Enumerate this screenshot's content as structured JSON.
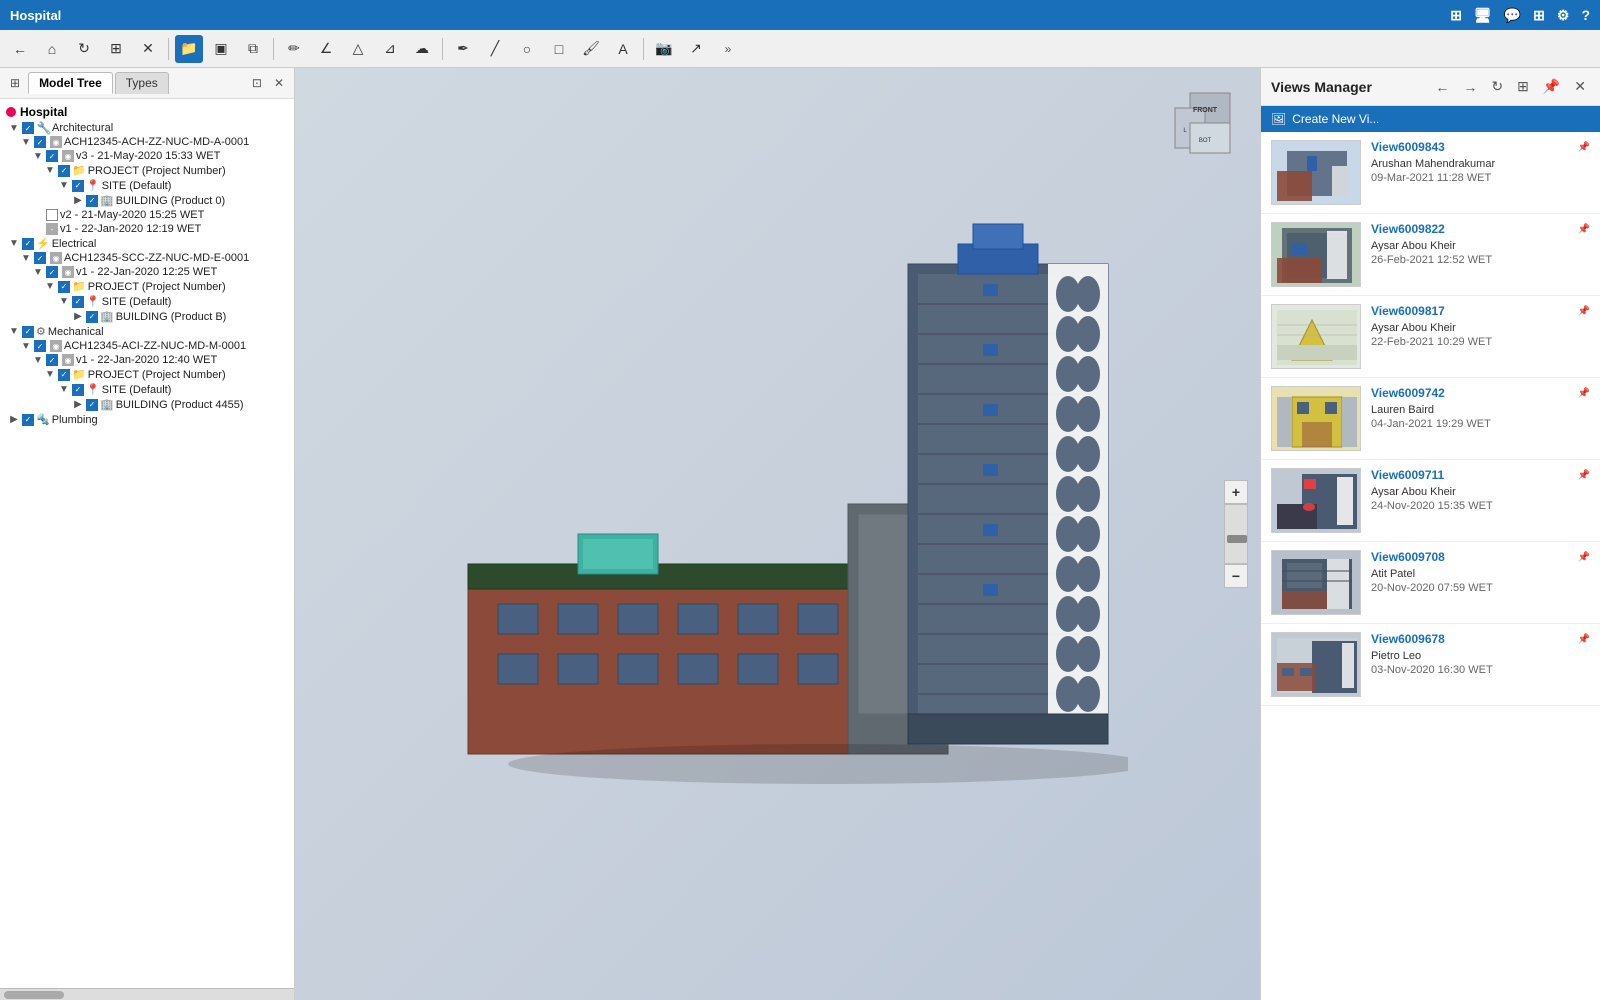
{
  "app": {
    "title": "Hospital",
    "topbar_icons": [
      "network",
      "monitor",
      "chat",
      "grid",
      "settings",
      "help"
    ]
  },
  "toolbar": {
    "buttons": [
      {
        "name": "back",
        "icon": "←",
        "active": false
      },
      {
        "name": "home",
        "icon": "⌂",
        "active": false
      },
      {
        "name": "refresh",
        "icon": "↻",
        "active": false
      },
      {
        "name": "hierarchy",
        "icon": "⊞",
        "active": false
      },
      {
        "name": "tool5",
        "icon": "✕",
        "active": false
      },
      {
        "name": "open",
        "icon": "📁",
        "active": true
      },
      {
        "name": "cube",
        "icon": "▣",
        "active": false
      },
      {
        "name": "copy",
        "icon": "⧉",
        "active": false
      },
      {
        "name": "pencil",
        "icon": "✏",
        "active": false
      },
      {
        "name": "angle",
        "icon": "∠",
        "active": false
      },
      {
        "name": "triangle",
        "icon": "△",
        "active": false
      },
      {
        "name": "measure",
        "icon": "⊿",
        "active": false
      },
      {
        "name": "cloud",
        "icon": "☁",
        "active": false
      },
      {
        "name": "pen",
        "icon": "✒",
        "active": false
      },
      {
        "name": "line",
        "icon": "╱",
        "active": false
      },
      {
        "name": "circle",
        "icon": "○",
        "active": false
      },
      {
        "name": "rect",
        "icon": "□",
        "active": false
      },
      {
        "name": "brush",
        "icon": "🖌",
        "active": false
      },
      {
        "name": "text",
        "icon": "A",
        "active": false
      },
      {
        "name": "camera",
        "icon": "📷",
        "active": false
      },
      {
        "name": "move",
        "icon": "↗",
        "active": false
      },
      {
        "name": "more",
        "icon": "»",
        "active": false
      }
    ]
  },
  "panel": {
    "tabs": [
      {
        "label": "Model Tree",
        "active": true
      },
      {
        "label": "Types",
        "active": false
      }
    ],
    "tree": {
      "root": "Hospital",
      "items": [
        {
          "level": 0,
          "label": "Architectural",
          "arrow": "▼",
          "checked": "checked",
          "icon": "🔧",
          "type": "category"
        },
        {
          "level": 1,
          "label": "ACH12345-ACH-ZZ-NUC-MD-A-0001",
          "arrow": "▼",
          "checked": "checked",
          "icon": "📄",
          "type": "file"
        },
        {
          "level": 2,
          "label": "v3 - 21-May-2020 15:33 WET",
          "arrow": "▼",
          "checked": "checked",
          "icon": "📋",
          "type": "version"
        },
        {
          "level": 3,
          "label": "PROJECT (Project Number)",
          "arrow": "▼",
          "checked": "checked",
          "icon": "📁",
          "type": "project"
        },
        {
          "level": 4,
          "label": "SITE (Default)",
          "arrow": "▼",
          "checked": "checked",
          "icon": "📍",
          "type": "site"
        },
        {
          "level": 5,
          "label": "BUILDING (Product 0)",
          "arrow": "▶",
          "checked": "checked",
          "icon": "🏢",
          "type": "building"
        },
        {
          "level": 2,
          "label": "v2 - 21-May-2020 15:25 WET",
          "arrow": "",
          "checked": "unchecked",
          "icon": "📋",
          "type": "version"
        },
        {
          "level": 2,
          "label": "v1 - 22-Jan-2020 12:19 WET",
          "arrow": "",
          "checked": "partial",
          "icon": "📋",
          "type": "version"
        },
        {
          "level": 0,
          "label": "Electrical",
          "arrow": "▼",
          "checked": "checked",
          "icon": "⚡",
          "type": "category"
        },
        {
          "level": 1,
          "label": "ACH12345-SCC-ZZ-NUC-MD-E-0001",
          "arrow": "▼",
          "checked": "checked",
          "icon": "📄",
          "type": "file"
        },
        {
          "level": 2,
          "label": "v1 - 22-Jan-2020 12:25 WET",
          "arrow": "▼",
          "checked": "checked",
          "icon": "📋",
          "type": "version"
        },
        {
          "level": 3,
          "label": "PROJECT (Project Number)",
          "arrow": "▼",
          "checked": "checked",
          "icon": "📁",
          "type": "project"
        },
        {
          "level": 4,
          "label": "SITE (Default)",
          "arrow": "▼",
          "checked": "checked",
          "icon": "📍",
          "type": "site"
        },
        {
          "level": 5,
          "label": "BUILDING (Product B)",
          "arrow": "▶",
          "checked": "checked",
          "icon": "🏢",
          "type": "building"
        },
        {
          "level": 0,
          "label": "Mechanical",
          "arrow": "▼",
          "checked": "checked",
          "icon": "⚙",
          "type": "category"
        },
        {
          "level": 1,
          "label": "ACH12345-ACI-ZZ-NUC-MD-M-0001",
          "arrow": "▼",
          "checked": "checked",
          "icon": "📄",
          "type": "file"
        },
        {
          "level": 2,
          "label": "v1 - 22-Jan-2020 12:40 WET",
          "arrow": "▼",
          "checked": "checked",
          "icon": "📋",
          "type": "version"
        },
        {
          "level": 3,
          "label": "PROJECT (Project Number)",
          "arrow": "▼",
          "checked": "checked",
          "icon": "📁",
          "type": "project"
        },
        {
          "level": 4,
          "label": "SITE (Default)",
          "arrow": "▼",
          "checked": "checked",
          "icon": "📍",
          "type": "site"
        },
        {
          "level": 5,
          "label": "BUILDING (Product 4455)",
          "arrow": "▶",
          "checked": "checked",
          "icon": "🏢",
          "type": "building"
        },
        {
          "level": 0,
          "label": "Plumbing",
          "arrow": "▶",
          "checked": "checked",
          "icon": "🔩",
          "type": "category"
        }
      ]
    }
  },
  "views_manager": {
    "title": "Views Manager",
    "create_new_label": "Create New Vi...",
    "toolbar_icons": [
      "back",
      "forward",
      "refresh",
      "layout",
      "pin",
      "close"
    ],
    "views": [
      {
        "id": "view1",
        "name": "View6009843",
        "author": "Arushan Mahendrakumar",
        "date": "09-Mar-2021 11:28 WET",
        "thumb_color": "#c8d8e8",
        "thumb_type": "building_blue"
      },
      {
        "id": "view2",
        "name": "View6009822",
        "author": "Aysar Abou Kheir",
        "date": "26-Feb-2021 12:52 WET",
        "thumb_color": "#d0d8c0",
        "thumb_type": "building_green"
      },
      {
        "id": "view3",
        "name": "View6009817",
        "author": "Aysar Abou Kheir",
        "date": "22-Feb-2021 10:29 WET",
        "thumb_color": "#e8e8d0",
        "thumb_type": "plan_yellow"
      },
      {
        "id": "view4",
        "name": "View6009742",
        "author": "Lauren Baird",
        "date": "04-Jan-2021 19:29 WET",
        "thumb_color": "#e8e0c0",
        "thumb_type": "door_yellow"
      },
      {
        "id": "view5",
        "name": "View6009711",
        "author": "Aysar Abou Kheir",
        "date": "24-Nov-2020 15:35 WET",
        "thumb_color": "#c8d0d8",
        "thumb_type": "building_dark"
      },
      {
        "id": "view6",
        "name": "View6009708",
        "author": "Atit Patel",
        "date": "20-Nov-2020 07:59 WET",
        "thumb_color": "#c0c8d0",
        "thumb_type": "building_angle"
      },
      {
        "id": "view7",
        "name": "View6009678",
        "author": "Pietro Leo",
        "date": "03-Nov-2020 16:30 WET",
        "thumb_color": "#c8d0d8",
        "thumb_type": "building_detail"
      }
    ]
  }
}
